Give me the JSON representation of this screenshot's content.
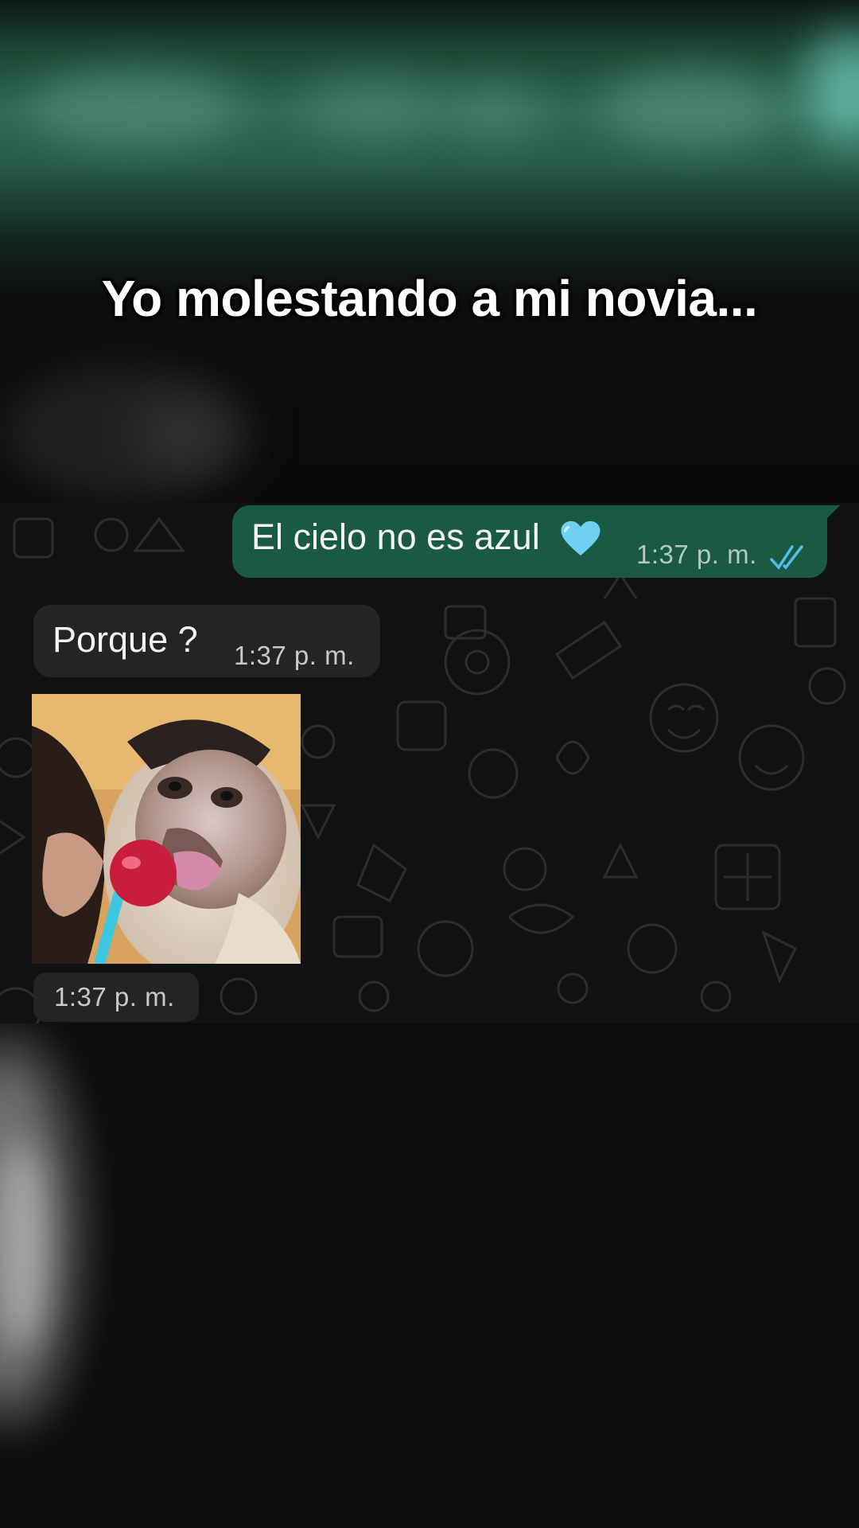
{
  "caption": "Yo molestando a mi novia...",
  "messages": [
    {
      "direction": "outgoing",
      "text": "El cielo no es azul",
      "emoji": "light-blue-heart",
      "time": "1:37 p. m.",
      "status": "read-double-check"
    },
    {
      "direction": "incoming",
      "text": "Porque ?",
      "time": "1:37 p. m."
    },
    {
      "direction": "incoming",
      "type": "sticker",
      "sticker": "monkey-licking-lollipop",
      "time": "1:37 p. m."
    }
  ],
  "colors": {
    "outgoing_bubble": "#1a5a43",
    "incoming_bubble": "#232425",
    "chat_background": "#111212",
    "read_ticks": "#53bdeb",
    "heart": "#6fd0f2"
  }
}
